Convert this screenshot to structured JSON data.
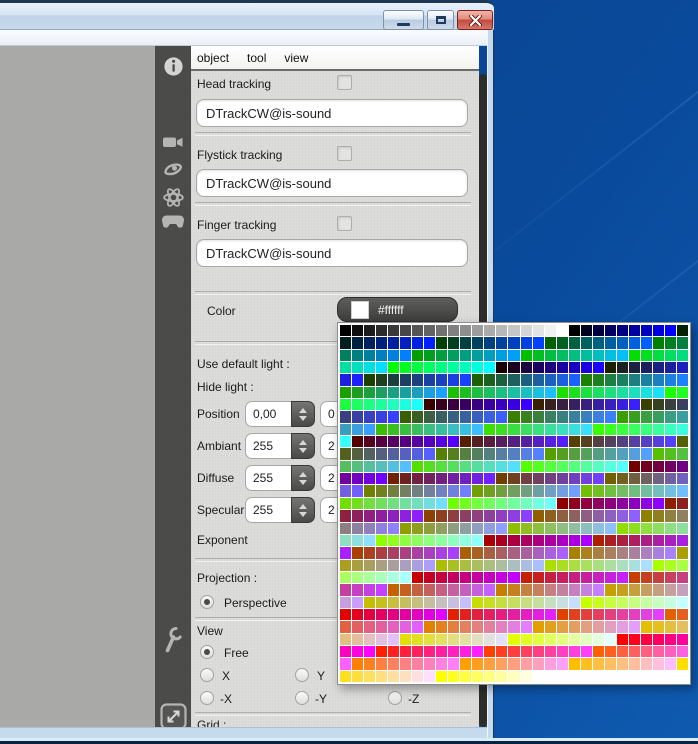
{
  "titlebar": {
    "buttons": [
      "minimize",
      "maximize",
      "close"
    ]
  },
  "menu": {
    "items": [
      {
        "label": "object"
      },
      {
        "label": "tool"
      },
      {
        "label": "view"
      }
    ]
  },
  "panel": {
    "tracking": [
      {
        "label": "Head tracking",
        "value": "DTrackCW@is-sound",
        "checked": false
      },
      {
        "label": "Flystick tracking",
        "value": "DTrackCW@is-sound",
        "checked": false
      },
      {
        "label": "Finger tracking",
        "value": "DTrackCW@is-sound",
        "checked": false
      }
    ],
    "color": {
      "label": "Color",
      "hex": "#ffffff",
      "swatch": "#ffffff"
    },
    "light": {
      "use_default_label": "Use default light :",
      "hide_label": "Hide light :",
      "rows": [
        {
          "label": "Position",
          "value": "0,00",
          "value2": "0"
        },
        {
          "label": "Ambiant",
          "value": "255",
          "value2": "2"
        },
        {
          "label": "Diffuse",
          "value": "255",
          "value2": "2"
        },
        {
          "label": "Specular",
          "value": "255",
          "value2": "2"
        }
      ],
      "exponent_label": "Exponent"
    },
    "projection": {
      "label": "Projection :",
      "option": {
        "label": "Perspective",
        "selected": true
      }
    },
    "view": {
      "label": "View",
      "free": {
        "label": "Free",
        "selected": true
      },
      "x": {
        "label": "X",
        "selected": false
      },
      "y": {
        "label": "Y",
        "selected": false
      },
      "negx": {
        "label": "-X",
        "selected": false
      },
      "negy": {
        "label": "-Y",
        "selected": false
      },
      "negz": {
        "label": "-Z",
        "selected": false
      }
    },
    "grid": {
      "label": "Grid :"
    }
  },
  "palette": {
    "columns": 29,
    "grayscale_steps": 19,
    "red_levels": 10,
    "green_levels": 9,
    "blue_levels": 9,
    "order": "blue-fastest",
    "background": "#ffffff"
  },
  "colors": {
    "desktop": "#0a4a9c",
    "sidebar": "#4b4b49",
    "panel": "#dbdbd9",
    "viewport": "#a9a9a7",
    "window_border": "#c6daee",
    "close_button": "#c44a3c",
    "scrollbar": "#2d2d2b"
  }
}
